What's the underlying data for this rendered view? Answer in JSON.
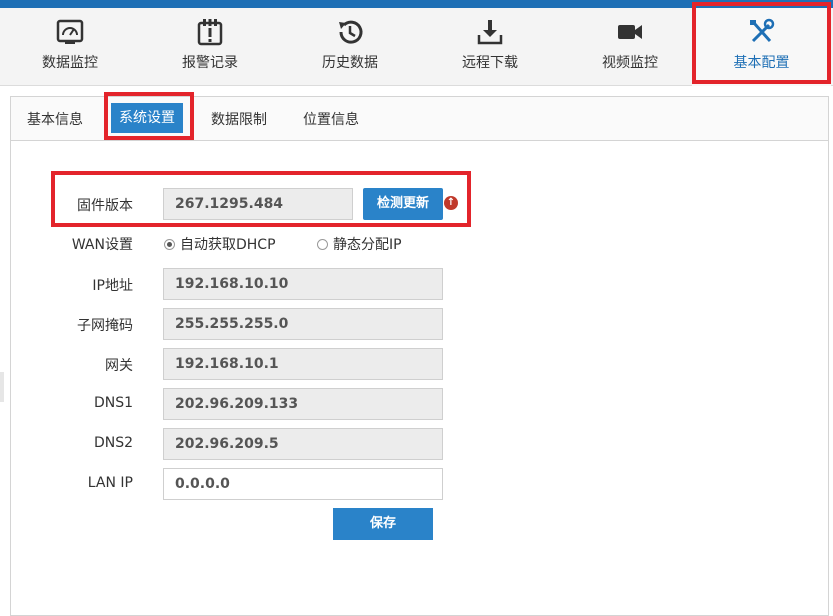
{
  "nav": {
    "items": [
      {
        "label": "数据监控",
        "icon": "dashboard-icon"
      },
      {
        "label": "报警记录",
        "icon": "alarm-calendar-icon"
      },
      {
        "label": "历史数据",
        "icon": "history-icon"
      },
      {
        "label": "远程下载",
        "icon": "download-icon"
      },
      {
        "label": "视频监控",
        "icon": "video-camera-icon"
      },
      {
        "label": "基本配置",
        "icon": "tools-icon"
      }
    ],
    "active_index": 5
  },
  "tabs": [
    {
      "label": "基本信息"
    },
    {
      "label": "系统设置"
    },
    {
      "label": "数据限制"
    },
    {
      "label": "位置信息"
    }
  ],
  "firmware": {
    "label": "固件版本",
    "value": "267.1295.484",
    "check_button": "检测更新",
    "update_badge": "↑"
  },
  "wan": {
    "label": "WAN设置",
    "options": [
      {
        "label": "自动获取DHCP",
        "selected": true
      },
      {
        "label": "静态分配IP",
        "selected": false
      }
    ]
  },
  "fields": {
    "ip": {
      "label": "IP地址",
      "value": "192.168.10.10"
    },
    "mask": {
      "label": "子网掩码",
      "value": "255.255.255.0"
    },
    "gateway": {
      "label": "网关",
      "value": "192.168.10.1"
    },
    "dns1": {
      "label": "DNS1",
      "value": "202.96.209.133"
    },
    "dns2": {
      "label": "DNS2",
      "value": "202.96.209.5"
    },
    "lanip": {
      "label": "LAN IP",
      "value": "0.0.0.0"
    }
  },
  "save_button": "保存",
  "colors": {
    "accent": "#2a83c9",
    "highlight": "#e3242b",
    "topbar": "#1e6fb5"
  }
}
